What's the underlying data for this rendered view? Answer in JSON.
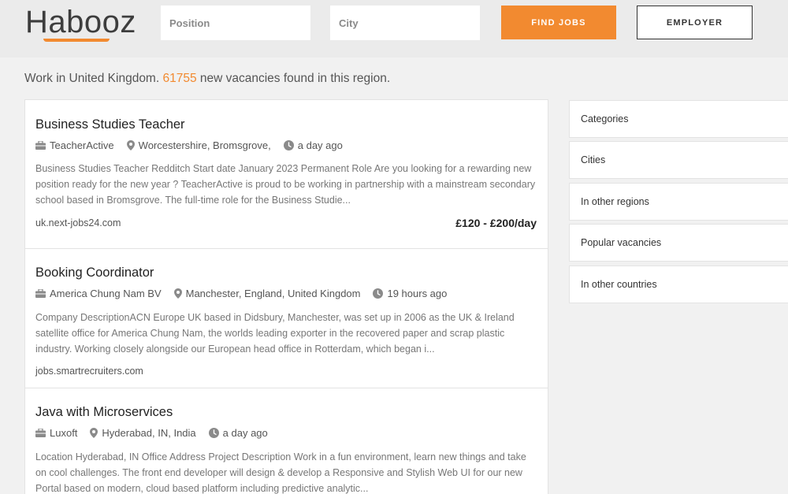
{
  "header": {
    "logo_text": "Habooz",
    "position_placeholder": "Position",
    "city_placeholder": "City",
    "find_jobs_label": "FIND JOBS",
    "employer_label": "EMPLOYER",
    "accent_color": "#f28a30"
  },
  "summary": {
    "prefix": "Work in United Kingdom.",
    "count": "61755",
    "suffix": "new vacancies found in this region."
  },
  "jobs": [
    {
      "title": "Business Studies Teacher",
      "company": "TeacherActive",
      "location": "Worcestershire, Bromsgrove,",
      "posted": "a day ago",
      "description": "Business Studies Teacher Redditch Start date January 2023 Permanent Role Are you looking for a rewarding new position ready for the new year ? TeacherActive is proud to be working in partnership with a mainstream secondary school based in Bromsgrove. The full-time role for the Business Studie...",
      "source": "uk.next-jobs24.com",
      "salary": "£120 - £200/day"
    },
    {
      "title": "Booking Coordinator",
      "company": "America Chung Nam BV",
      "location": "Manchester, England, United Kingdom",
      "posted": "19 hours ago",
      "description": "Company DescriptionACN Europe UK based in Didsbury, Manchester, was set up in 2006 as the UK & Ireland satellite office for America Chung Nam, the worlds leading exporter in the recovered paper and scrap plastic industry. Working closely alongside our European head office in Rotterdam, which began i...",
      "source": "jobs.smartrecruiters.com",
      "salary": ""
    },
    {
      "title": "Java with Microservices",
      "company": "Luxoft",
      "location": "Hyderabad, IN, India",
      "posted": "a day ago",
      "description": "Location Hyderabad, IN Office Address Project Description Work in a fun environment, learn new things and take on cool challenges. The front end developer will design & develop a Responsive and Stylish Web UI for our new Portal based on modern, cloud based platform including predictive analytic...",
      "source": "",
      "salary": ""
    }
  ],
  "sidebar": {
    "items": [
      {
        "label": "Categories"
      },
      {
        "label": "Cities"
      },
      {
        "label": "In other regions"
      },
      {
        "label": "Popular vacancies"
      },
      {
        "label": "In other countries"
      }
    ]
  },
  "icons": {
    "company": "briefcase-icon",
    "location": "map-pin-icon",
    "time": "clock-icon"
  }
}
